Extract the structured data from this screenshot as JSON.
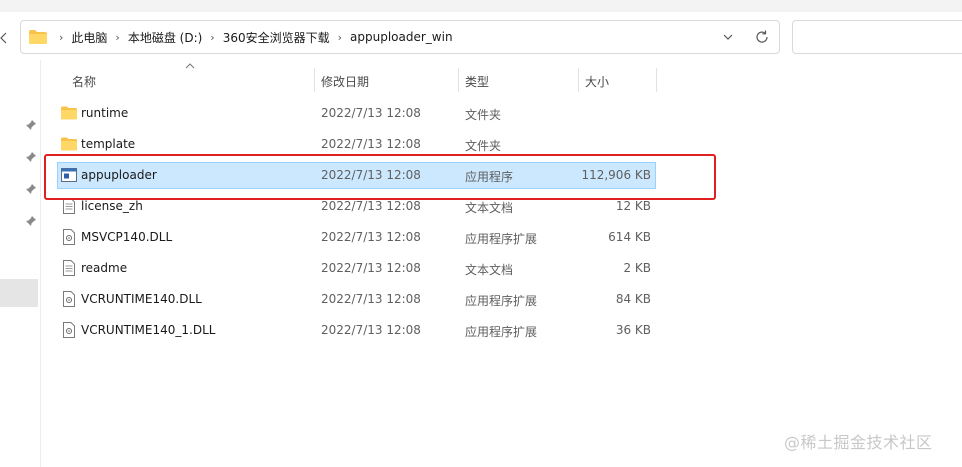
{
  "breadcrumbs": [
    "此电脑",
    "本地磁盘 (D:)",
    "360安全浏览器下载",
    "appuploader_win"
  ],
  "columns": {
    "name": "名称",
    "date": "修改日期",
    "type": "类型",
    "size": "大小"
  },
  "files": [
    {
      "name": "runtime",
      "date": "2022/7/13 12:08",
      "type": "文件夹",
      "size": "",
      "icon": "folder-icon"
    },
    {
      "name": "template",
      "date": "2022/7/13 12:08",
      "type": "文件夹",
      "size": "",
      "icon": "folder-icon"
    },
    {
      "name": "appuploader",
      "date": "2022/7/13 12:08",
      "type": "应用程序",
      "size": "112,906 KB",
      "icon": "application-icon",
      "selected": true
    },
    {
      "name": "license_zh",
      "date": "2022/7/13 12:08",
      "type": "文本文档",
      "size": "12 KB",
      "icon": "text-document-icon"
    },
    {
      "name": "MSVCP140.DLL",
      "date": "2022/7/13 12:08",
      "type": "应用程序扩展",
      "size": "614 KB",
      "icon": "dll-icon"
    },
    {
      "name": "readme",
      "date": "2022/7/13 12:08",
      "type": "文本文档",
      "size": "2 KB",
      "icon": "text-document-icon"
    },
    {
      "name": "VCRUNTIME140.DLL",
      "date": "2022/7/13 12:08",
      "type": "应用程序扩展",
      "size": "84 KB",
      "icon": "dll-icon"
    },
    {
      "name": "VCRUNTIME140_1.DLL",
      "date": "2022/7/13 12:08",
      "type": "应用程序扩展",
      "size": "36 KB",
      "icon": "dll-icon"
    }
  ],
  "watermark": "@稀土掘金技术社区",
  "colors": {
    "selection": "#cce8ff",
    "highlight": "#e0201f",
    "folder": "#f8c34a"
  }
}
